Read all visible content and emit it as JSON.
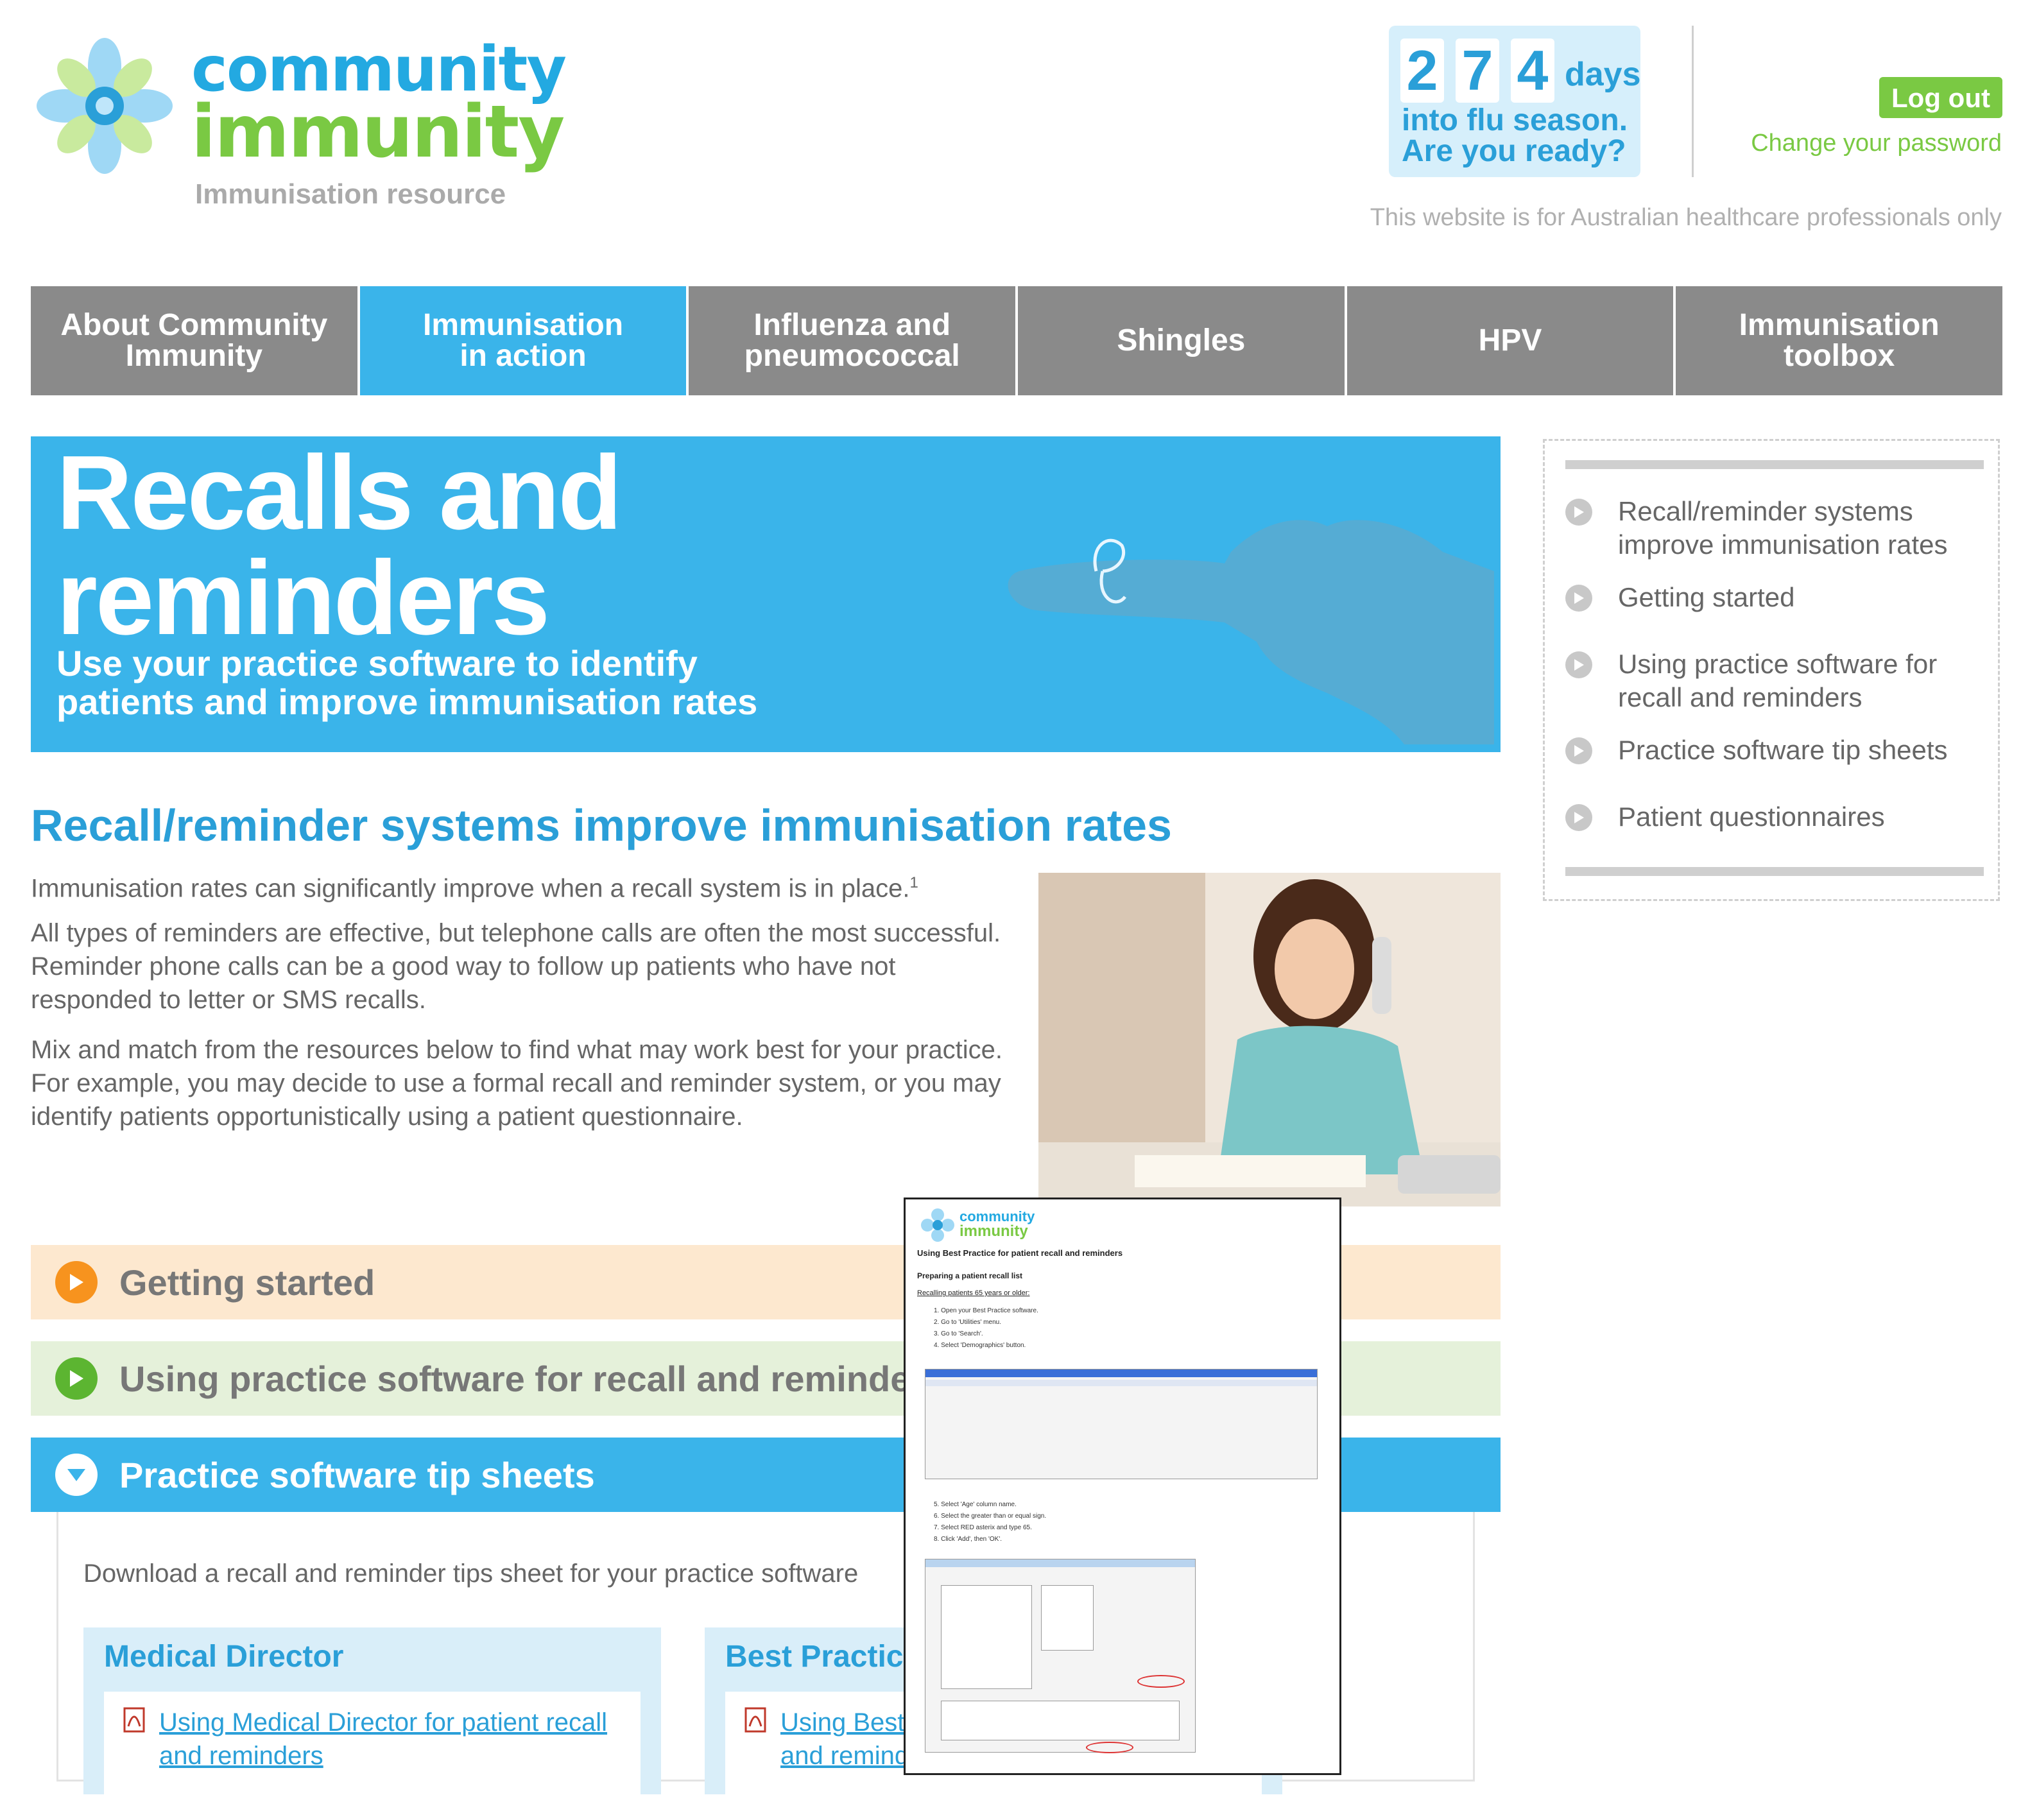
{
  "brand": {
    "name_line1": "community",
    "name_line2": "immunity",
    "tagline": "Immunisation resource"
  },
  "counter": {
    "digits": [
      "2",
      "7",
      "4"
    ],
    "unit": "days",
    "line1": "into flu season.",
    "line2": "Are you ready?"
  },
  "account": {
    "logout": "Log out",
    "change_password": "Change your password"
  },
  "notice": "This website is for Australian healthcare professionals only",
  "nav": [
    {
      "label": "About Community\nImmunity"
    },
    {
      "label": "Immunisation\nin action"
    },
    {
      "label": "Influenza and\npneumococcal"
    },
    {
      "label": "Shingles"
    },
    {
      "label": "HPV"
    },
    {
      "label": "Immunisation toolbox"
    }
  ],
  "hero": {
    "title": "Recalls and\nreminders",
    "subtitle": "Use your practice software to identify patients and improve immunisation rates"
  },
  "sidebar": {
    "items": [
      {
        "label": "Recall/reminder systems improve immunisation rates"
      },
      {
        "label": "Getting started"
      },
      {
        "label": "Using practice software for recall and reminders"
      },
      {
        "label": "Practice software tip sheets"
      },
      {
        "label": "Patient questionnaires"
      }
    ]
  },
  "intro": {
    "heading": "Recall/reminder systems improve immunisation rates",
    "p1": "Immunisation rates can significantly improve when a recall system is in place.",
    "p1_sup": "1",
    "p2": "All types of reminders are effective, but telephone calls are often the most successful. Reminder phone calls can be a good way to follow up patients who have not responded to letter or SMS recalls.",
    "p3": "Mix and match from the resources below to find what may work best for your practice. For example, you may decide to use a formal recall and reminder system, or you may identify patients opportunistically using a patient questionnaire."
  },
  "accordions": [
    {
      "label": "Getting started"
    },
    {
      "label": "Using practice software for recall and reminders"
    },
    {
      "label": "Practice software tip sheets"
    }
  ],
  "tips": {
    "intro": "Download a recall and reminder tips sheet for your practice software",
    "boxes": [
      {
        "heading": "Medical Director",
        "link": "Using Medical Director for patient recall and reminders"
      },
      {
        "heading": "Best Practice",
        "link": "Using Best Practice for patient recall and reminders"
      }
    ]
  },
  "preview": {
    "title": "Using Best Practice for patient recall and reminders",
    "section": "Preparing a patient recall list",
    "subsection": "Recalling patients 65 years or older:",
    "steps_a": [
      "1.   Open your Best Practice software.",
      "2.   Go to 'Utilities' menu.",
      "3.   Go to 'Search'.",
      "4.   Select 'Demographics' button."
    ],
    "steps_b": [
      "5.   Select 'Age' column name.",
      "6.   Select the greater than or equal sign.",
      "7.   Select RED asterix and type 65.",
      "8.   Click 'Add', then 'OK'."
    ]
  }
}
